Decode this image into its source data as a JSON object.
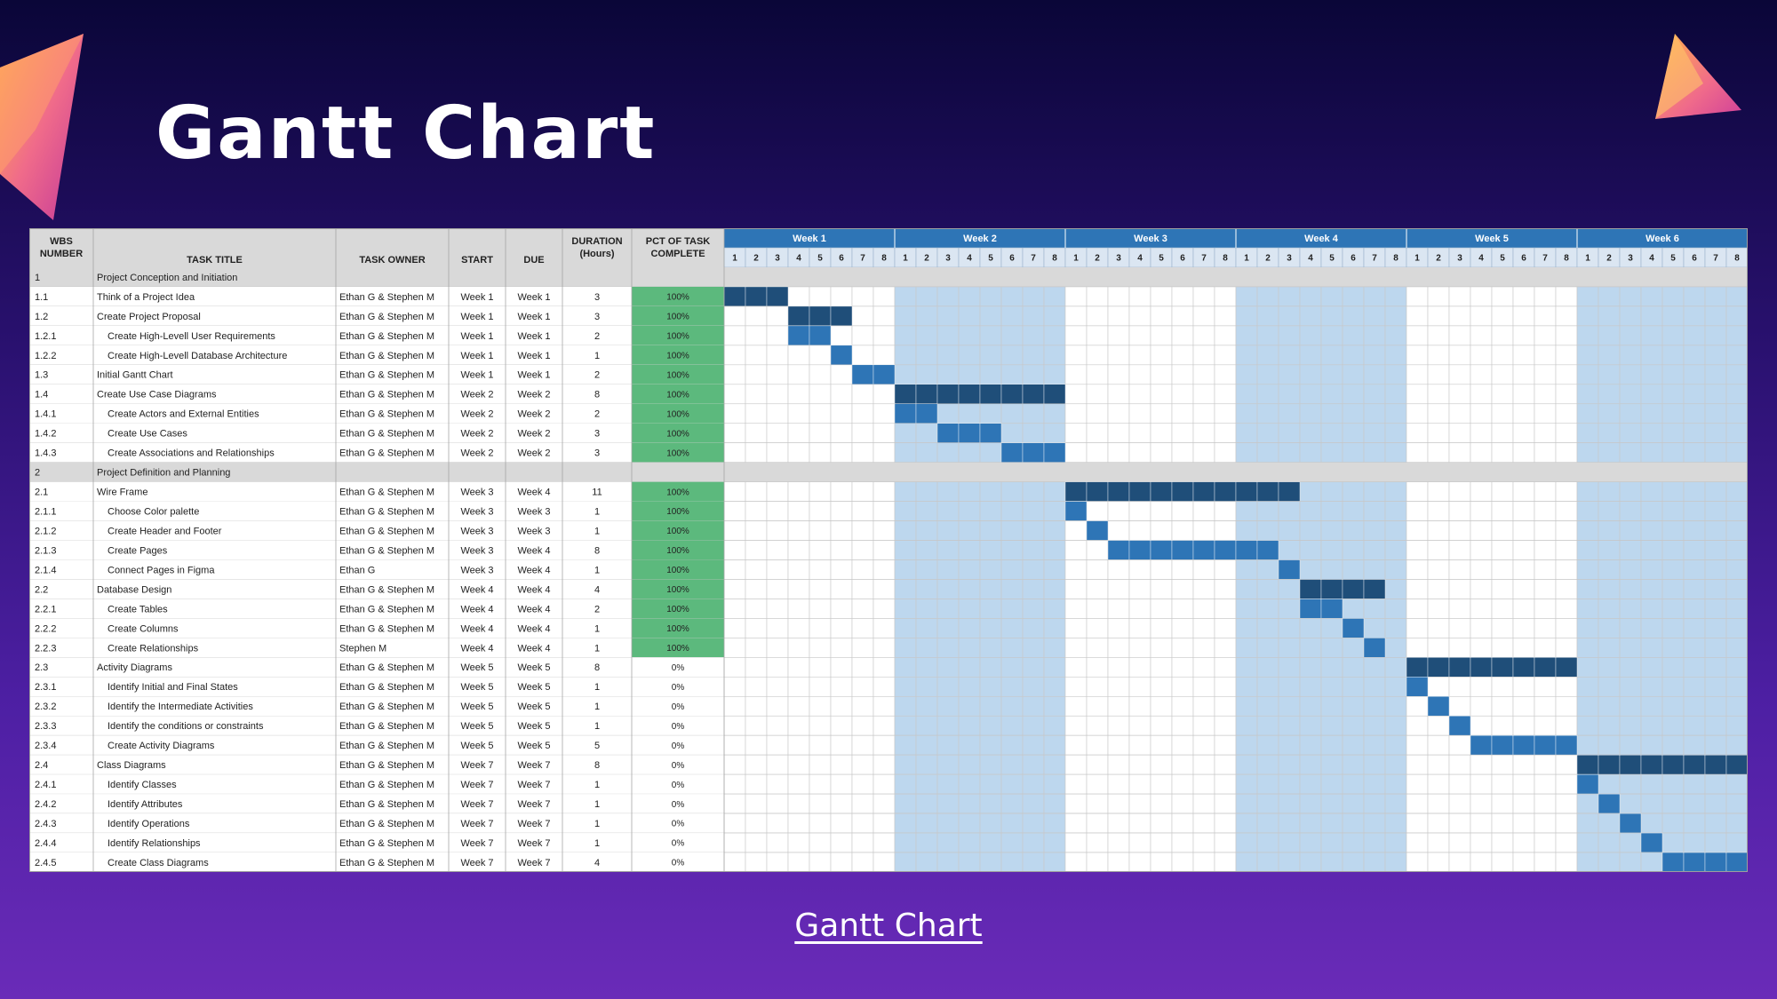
{
  "slide": {
    "title": "Gantt Chart",
    "footer_link": "Gantt Chart"
  },
  "colors": {
    "background_top": "#0a0638",
    "background_bottom": "#6a2bb8",
    "header_blue": "#2e75b6",
    "bar_parent": "#1f4e79",
    "bar_child": "#2e75b6",
    "week_shade": "#bdd7ee",
    "complete_green": "#5cb97d",
    "section_gray": "#d9d9d9"
  },
  "columns": {
    "wbs": "WBS NUMBER",
    "title": "TASK TITLE",
    "owner": "TASK OWNER",
    "start": "START",
    "due": "DUE",
    "duration": "DURATION (Hours)",
    "pct": "PCT OF TASK COMPLETE"
  },
  "weeks": [
    "Week 1",
    "Week 2",
    "Week 3",
    "Week 4",
    "Week 5",
    "Week 6"
  ],
  "slots_per_week": [
    "1",
    "2",
    "3",
    "4",
    "5",
    "6",
    "7",
    "8"
  ],
  "rows": [
    {
      "wbs": "1",
      "title": "Project Conception and Initiation",
      "section": true
    },
    {
      "wbs": "1.1",
      "title": "Think of a Project Idea",
      "owner": "Ethan G & Stephen M",
      "start": "Week 1",
      "due": "Week 1",
      "duration": "3",
      "pct": "100%",
      "bar": [
        0,
        3
      ],
      "level": "parent"
    },
    {
      "wbs": "1.2",
      "title": "Create Project Proposal",
      "owner": "Ethan G & Stephen M",
      "start": "Week 1",
      "due": "Week 1",
      "duration": "3",
      "pct": "100%",
      "bar": [
        3,
        3
      ],
      "level": "parent"
    },
    {
      "wbs": "1.2.1",
      "title": "Create High-Levell User Requirements",
      "owner": "Ethan G & Stephen M",
      "start": "Week 1",
      "due": "Week 1",
      "duration": "2",
      "pct": "100%",
      "bar": [
        3,
        2
      ],
      "level": "child",
      "indent": true
    },
    {
      "wbs": "1.2.2",
      "title": "Create High-Levell Database Architecture",
      "owner": "Ethan G & Stephen M",
      "start": "Week 1",
      "due": "Week 1",
      "duration": "1",
      "pct": "100%",
      "bar": [
        5,
        1
      ],
      "level": "child",
      "indent": true
    },
    {
      "wbs": "1.3",
      "title": "Initial Gantt Chart",
      "owner": "Ethan G & Stephen M",
      "start": "Week 1",
      "due": "Week 1",
      "duration": "2",
      "pct": "100%",
      "bar": [
        6,
        2
      ],
      "level": "child"
    },
    {
      "wbs": "1.4",
      "title": "Create Use Case Diagrams",
      "owner": "Ethan G & Stephen M",
      "start": "Week 2",
      "due": "Week 2",
      "duration": "8",
      "pct": "100%",
      "bar": [
        8,
        8
      ],
      "level": "parent"
    },
    {
      "wbs": "1.4.1",
      "title": "Create Actors and External Entities",
      "owner": "Ethan G & Stephen M",
      "start": "Week 2",
      "due": "Week 2",
      "duration": "2",
      "pct": "100%",
      "bar": [
        8,
        2
      ],
      "level": "child",
      "indent": true
    },
    {
      "wbs": "1.4.2",
      "title": "Create Use Cases",
      "owner": "Ethan G & Stephen M",
      "start": "Week 2",
      "due": "Week 2",
      "duration": "3",
      "pct": "100%",
      "bar": [
        10,
        3
      ],
      "level": "child",
      "indent": true
    },
    {
      "wbs": "1.4.3",
      "title": "Create Associations and Relationships",
      "owner": "Ethan G & Stephen M",
      "start": "Week 2",
      "due": "Week 2",
      "duration": "3",
      "pct": "100%",
      "bar": [
        13,
        3
      ],
      "level": "child",
      "indent": true
    },
    {
      "wbs": "2",
      "title": "Project Definition and Planning",
      "section": true
    },
    {
      "wbs": "2.1",
      "title": "Wire Frame",
      "owner": "Ethan G & Stephen M",
      "start": "Week 3",
      "due": "Week 4",
      "duration": "11",
      "pct": "100%",
      "bar": [
        16,
        11
      ],
      "level": "parent"
    },
    {
      "wbs": "2.1.1",
      "title": "Choose Color palette",
      "owner": "Ethan G & Stephen M",
      "start": "Week 3",
      "due": "Week 3",
      "duration": "1",
      "pct": "100%",
      "bar": [
        16,
        1
      ],
      "level": "child",
      "indent": true
    },
    {
      "wbs": "2.1.2",
      "title": "Create Header and Footer",
      "owner": "Ethan G & Stephen M",
      "start": "Week 3",
      "due": "Week 3",
      "duration": "1",
      "pct": "100%",
      "bar": [
        17,
        1
      ],
      "level": "child",
      "indent": true
    },
    {
      "wbs": "2.1.3",
      "title": "Create Pages",
      "owner": "Ethan G & Stephen M",
      "start": "Week 3",
      "due": "Week 4",
      "duration": "8",
      "pct": "100%",
      "bar": [
        18,
        8
      ],
      "level": "child",
      "indent": true
    },
    {
      "wbs": "2.1.4",
      "title": "Connect Pages in Figma",
      "owner": "Ethan G",
      "start": "Week 3",
      "due": "Week 4",
      "duration": "1",
      "pct": "100%",
      "bar": [
        26,
        1
      ],
      "level": "child",
      "indent": true
    },
    {
      "wbs": "2.2",
      "title": "Database Design",
      "owner": "Ethan G & Stephen M",
      "start": "Week 4",
      "due": "Week 4",
      "duration": "4",
      "pct": "100%",
      "bar": [
        27,
        4
      ],
      "level": "parent"
    },
    {
      "wbs": "2.2.1",
      "title": "Create Tables",
      "owner": "Ethan G & Stephen M",
      "start": "Week 4",
      "due": "Week 4",
      "duration": "2",
      "pct": "100%",
      "bar": [
        27,
        2
      ],
      "level": "child",
      "indent": true
    },
    {
      "wbs": "2.2.2",
      "title": "Create Columns",
      "owner": "Ethan G & Stephen M",
      "start": "Week 4",
      "due": "Week 4",
      "duration": "1",
      "pct": "100%",
      "bar": [
        29,
        1
      ],
      "level": "child",
      "indent": true
    },
    {
      "wbs": "2.2.3",
      "title": "Create Relationships",
      "owner": "Stephen M",
      "start": "Week 4",
      "due": "Week 4",
      "duration": "1",
      "pct": "100%",
      "bar": [
        30,
        1
      ],
      "level": "child",
      "indent": true
    },
    {
      "wbs": "2.3",
      "title": "Activity Diagrams",
      "owner": "Ethan G & Stephen M",
      "start": "Week 5",
      "due": "Week 5",
      "duration": "8",
      "pct": "0%",
      "bar": [
        32,
        8
      ],
      "level": "parent"
    },
    {
      "wbs": "2.3.1",
      "title": "Identify Initial and Final States",
      "owner": "Ethan G & Stephen M",
      "start": "Week 5",
      "due": "Week 5",
      "duration": "1",
      "pct": "0%",
      "bar": [
        32,
        1
      ],
      "level": "child",
      "indent": true
    },
    {
      "wbs": "2.3.2",
      "title": "Identify the Intermediate Activities",
      "owner": "Ethan G & Stephen M",
      "start": "Week 5",
      "due": "Week 5",
      "duration": "1",
      "pct": "0%",
      "bar": [
        33,
        1
      ],
      "level": "child",
      "indent": true
    },
    {
      "wbs": "2.3.3",
      "title": "Identify the conditions or constraints",
      "owner": "Ethan G & Stephen M",
      "start": "Week 5",
      "due": "Week 5",
      "duration": "1",
      "pct": "0%",
      "bar": [
        34,
        1
      ],
      "level": "child",
      "indent": true
    },
    {
      "wbs": "2.3.4",
      "title": "Create Activity Diagrams",
      "owner": "Ethan G & Stephen M",
      "start": "Week 5",
      "due": "Week 5",
      "duration": "5",
      "pct": "0%",
      "bar": [
        35,
        5
      ],
      "level": "child",
      "indent": true
    },
    {
      "wbs": "2.4",
      "title": "Class Diagrams",
      "owner": "Ethan G & Stephen M",
      "start": "Week 7",
      "due": "Week 7",
      "duration": "8",
      "pct": "0%",
      "bar": [
        40,
        8
      ],
      "level": "parent"
    },
    {
      "wbs": "2.4.1",
      "title": "Identify Classes",
      "owner": "Ethan G & Stephen M",
      "start": "Week 7",
      "due": "Week 7",
      "duration": "1",
      "pct": "0%",
      "bar": [
        40,
        1
      ],
      "level": "child",
      "indent": true
    },
    {
      "wbs": "2.4.2",
      "title": "Identify Attributes",
      "owner": "Ethan G & Stephen M",
      "start": "Week 7",
      "due": "Week 7",
      "duration": "1",
      "pct": "0%",
      "bar": [
        41,
        1
      ],
      "level": "child",
      "indent": true
    },
    {
      "wbs": "2.4.3",
      "title": "Identify Operations",
      "owner": "Ethan G & Stephen M",
      "start": "Week 7",
      "due": "Week 7",
      "duration": "1",
      "pct": "0%",
      "bar": [
        42,
        1
      ],
      "level": "child",
      "indent": true
    },
    {
      "wbs": "2.4.4",
      "title": "Identify Relationships",
      "owner": "Ethan G & Stephen M",
      "start": "Week 7",
      "due": "Week 7",
      "duration": "1",
      "pct": "0%",
      "bar": [
        43,
        1
      ],
      "level": "child",
      "indent": true
    },
    {
      "wbs": "2.4.5",
      "title": "Create Class Diagrams",
      "owner": "Ethan G & Stephen M",
      "start": "Week 7",
      "due": "Week 7",
      "duration": "4",
      "pct": "0%",
      "bar": [
        44,
        4
      ],
      "level": "child",
      "indent": true
    }
  ]
}
